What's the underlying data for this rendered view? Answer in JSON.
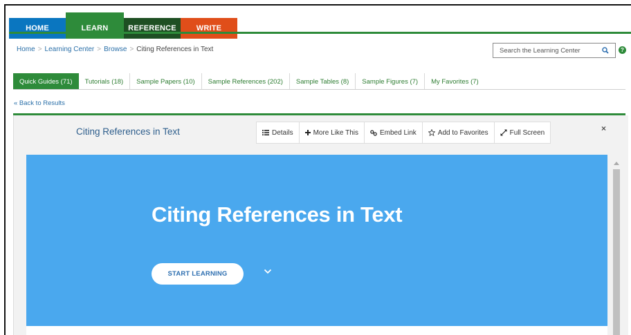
{
  "topnav": {
    "tabs": [
      {
        "label": "HOME"
      },
      {
        "label": "LEARN"
      },
      {
        "label": "REFERENCE"
      },
      {
        "label": "WRITE"
      }
    ],
    "active": "LEARN"
  },
  "breadcrumb": {
    "items": [
      "Home",
      "Learning Center",
      "Browse",
      "Citing References in Text"
    ],
    "separator": ">"
  },
  "search": {
    "placeholder": "Search the Learning Center",
    "icon": "search-icon"
  },
  "help": {
    "label": "?"
  },
  "subtabs": [
    {
      "label": "Quick Guides (71)"
    },
    {
      "label": "Tutorials (18)"
    },
    {
      "label": "Sample Papers (10)"
    },
    {
      "label": "Sample References (202)"
    },
    {
      "label": "Sample Tables (8)"
    },
    {
      "label": "Sample Figures (7)"
    },
    {
      "label": "My Favorites (7)"
    }
  ],
  "back_link": "« Back to Results",
  "panel": {
    "title": "Citing References in Text",
    "toolbar": {
      "details": "Details",
      "more_like_this": "More Like This",
      "embed_link": "Embed Link",
      "add_to_favorites": "Add to Favorites",
      "full_screen": "Full Screen"
    },
    "close": "×"
  },
  "hero": {
    "title": "Citing References in Text",
    "start_label": "START LEARNING"
  },
  "colors": {
    "home": "#0a76c0",
    "learn": "#2e8b3a",
    "reference": "#1e4f23",
    "write": "#e04e1a",
    "hero": "#4aa8ee"
  }
}
